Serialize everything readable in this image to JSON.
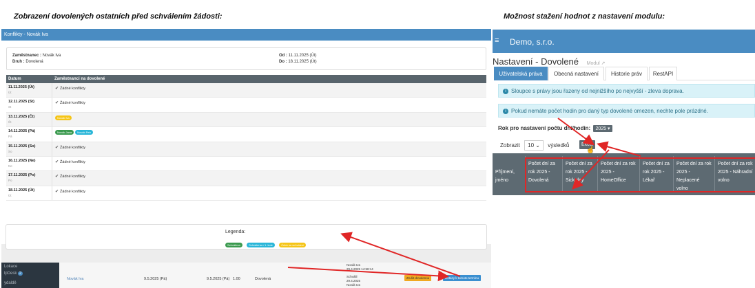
{
  "captions": {
    "left": "Zobrazení dovolených ostatních před schválením žádosti:",
    "right": "Možnost stažení hodnot z nastavení modulu:"
  },
  "conflicts_dialog": {
    "title": "Konflikty - Novák Iva",
    "employee_label": "Zaměstnanec :",
    "employee_value": "Novák Iva",
    "type_label": "Druh :",
    "type_value": "Dovolená",
    "from_label": "Od :",
    "from_value": "11.11.2025 (Út)",
    "to_label": "Do :",
    "to_value": "18.11.2025 (Út)",
    "col_date": "Datum",
    "col_employees": "Zaměstnanci na dovolené",
    "no_conflicts": "Žádné konflikty",
    "rows": [
      {
        "date": "11.11.2025 (Út)",
        "day": "Út",
        "kind": "none"
      },
      {
        "date": "12.11.2025 (St)",
        "day": "St",
        "kind": "none"
      },
      {
        "date": "13.11.2025 (Čt)",
        "day": "Čt",
        "kind": "yellow",
        "badge": "Novák Iva"
      },
      {
        "date": "14.11.2025 (Pá)",
        "day": "Pá",
        "kind": "two",
        "badge1": "Novák Jana",
        "badge2": "Novák Petr"
      },
      {
        "date": "15.11.2025 (So)",
        "day": "So",
        "kind": "none"
      },
      {
        "date": "16.11.2025 (Ne)",
        "day": "Ne",
        "kind": "none"
      },
      {
        "date": "17.11.2025 (Po)",
        "day": "Po",
        "kind": "none"
      },
      {
        "date": "18.11.2025 (Út)",
        "day": "Út",
        "kind": "none"
      }
    ],
    "legend_title": "Legenda:",
    "legend": {
      "approved": "Schválena",
      "first_round": "Schválena v 1. kole",
      "waiting": "Čeká na schválení"
    },
    "colors": {
      "approved": "#3b9a4f",
      "first_round": "#2ab6d8",
      "waiting": "#f5c518",
      "header": "#4a8cc2"
    }
  },
  "background_list": {
    "sidebar": {
      "locations": "Lokace",
      "helpdesk": "lpDesk",
      "helpdesk_count": "2",
      "last": "ydaldě"
    },
    "row": {
      "name": "Novák Iva",
      "date_from": "9.5.2025 (Pá)",
      "date_to": "9.5.2025 (Pá)",
      "hours": "1.00",
      "type": "Dovolená",
      "audit_1": "Novák Iva",
      "audit_2": "29.4.2025 14:58:14",
      "audit_3": "Schválil",
      "audit_4": "29.4.2025",
      "audit_5": "Novák Iva"
    },
    "btn_conflicts": "Zrušit dovolenou",
    "btn_term": "Dotazy k tomuto termínu"
  },
  "settings_page": {
    "company": "Demo, s.r.o.",
    "title": "Nastavení - Dovolené",
    "module_link": "Modul",
    "tabs": [
      "Uživatelská práva",
      "Obecná nastavení",
      "Historie práv",
      "RestAPI"
    ],
    "alert1": "Sloupce s právy jsou řazeny od nejnižšího po nejvyšší - zleva doprava.",
    "alert2": "Pokud nemáte počet hodin pro daný typ dovolené omezen, nechte pole prázdné.",
    "year_label": "Rok pro nastavení počtu dní/hodin:",
    "year_value": "2025",
    "show_label": "Zobrazit",
    "show_value": "10",
    "results_label": "výsledků",
    "excel_label": "Excel",
    "table_name_header": "Příjmení, jméno",
    "table_headers": [
      "Počet dní za rok 2025 - Dovolená",
      "Počet dní za rok 2025 - Sick day",
      "Počet dní za rok 2025 - HomeOffice",
      "Počet dní za rok 2025 - Lékař",
      "Počet dní za rok 2025 - Neplacené volno",
      "Počet dní za rok 2025 - Náhradní volno"
    ],
    "colors": {
      "topbar": "#4a8cc2",
      "highlight": "#e02626",
      "table_head": "#5d6a72"
    }
  }
}
